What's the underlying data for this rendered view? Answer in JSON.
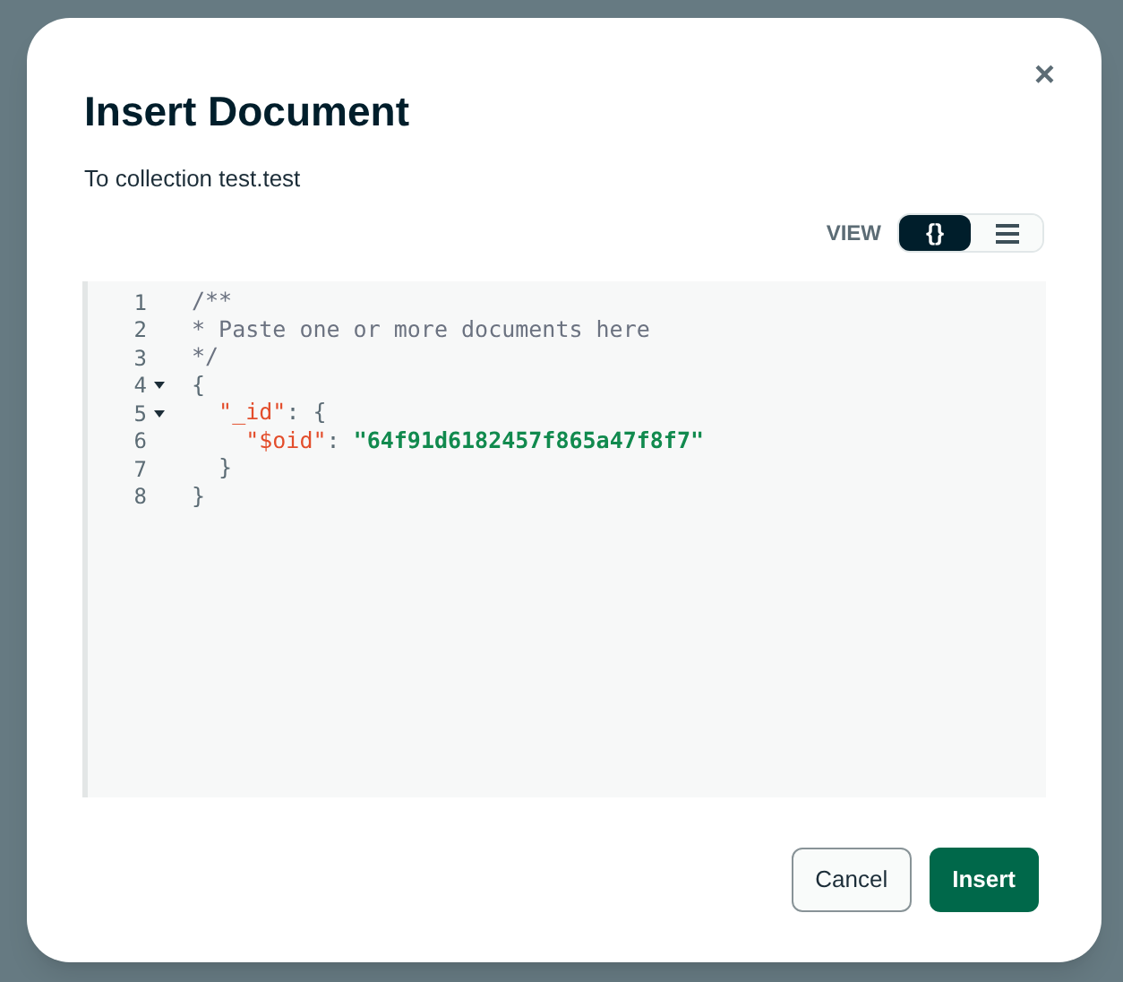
{
  "dialog": {
    "title": "Insert Document",
    "subtitle": "To collection test.test",
    "close": "×",
    "view": {
      "label": "VIEW",
      "options": [
        {
          "kind": "json",
          "label": "{}",
          "selected": true
        },
        {
          "kind": "list",
          "selected": false
        }
      ]
    },
    "editor": {
      "lines": [
        {
          "number": "1",
          "fold": false,
          "tokens": [
            {
              "kind": "comment",
              "text": "/**"
            }
          ]
        },
        {
          "number": "2",
          "fold": false,
          "tokens": [
            {
              "kind": "comment",
              "text": "* Paste one or more documents here"
            }
          ]
        },
        {
          "number": "3",
          "fold": false,
          "tokens": [
            {
              "kind": "comment",
              "text": "*/"
            }
          ]
        },
        {
          "number": "4",
          "fold": true,
          "tokens": [
            {
              "kind": "punct",
              "text": "{"
            }
          ]
        },
        {
          "number": "5",
          "fold": true,
          "tokens": [
            {
              "kind": "key",
              "text": "  \"_id\""
            },
            {
              "kind": "punct",
              "text": ": {"
            }
          ]
        },
        {
          "number": "6",
          "fold": false,
          "tokens": [
            {
              "kind": "key",
              "text": "    \"$oid\""
            },
            {
              "kind": "punct",
              "text": ": "
            },
            {
              "kind": "string",
              "text": "\"64f91d6182457f865a47f8f7\""
            }
          ]
        },
        {
          "number": "7",
          "fold": false,
          "tokens": [
            {
              "kind": "punct",
              "text": "  }"
            }
          ]
        },
        {
          "number": "8",
          "fold": false,
          "tokens": [
            {
              "kind": "punct",
              "text": "}"
            }
          ]
        }
      ]
    },
    "buttons": [
      {
        "kind": "secondary",
        "label": "Cancel"
      },
      {
        "kind": "primary",
        "label": "Insert"
      }
    ]
  }
}
